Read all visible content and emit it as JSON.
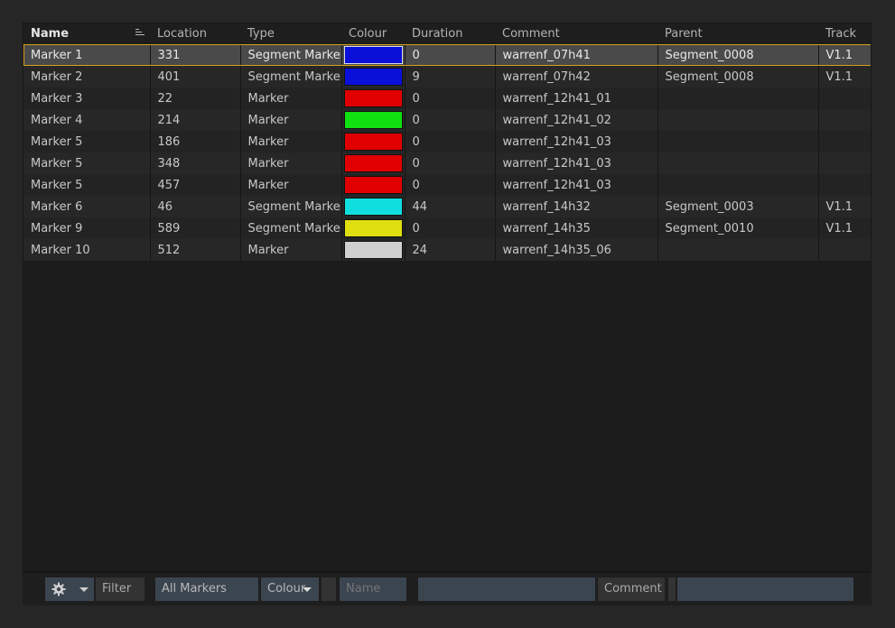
{
  "columns": [
    "Name",
    "Location",
    "Type",
    "Colour",
    "Duration",
    "Comment",
    "Parent",
    "Track"
  ],
  "rows": [
    {
      "name": "Marker 1",
      "location": "331",
      "type": "Segment Marker",
      "colour": "#0a10d8",
      "duration": "0",
      "comment": "warrenf_07h41",
      "parent": "Segment_0008",
      "track": "V1.1",
      "selected": true
    },
    {
      "name": "Marker 2",
      "location": "401",
      "type": "Segment Marker",
      "colour": "#0a10d8",
      "duration": "9",
      "comment": "warrenf_07h42",
      "parent": "Segment_0008",
      "track": "V1.1"
    },
    {
      "name": "Marker 3",
      "location": "22",
      "type": "Marker",
      "colour": "#e00000",
      "duration": "0",
      "comment": "warrenf_12h41_01",
      "parent": "",
      "track": ""
    },
    {
      "name": "Marker 4",
      "location": "214",
      "type": "Marker",
      "colour": "#10e010",
      "duration": "0",
      "comment": "warrenf_12h41_02",
      "parent": "",
      "track": ""
    },
    {
      "name": "Marker 5",
      "location": "186",
      "type": "Marker",
      "colour": "#e00000",
      "duration": "0",
      "comment": "warrenf_12h41_03",
      "parent": "",
      "track": ""
    },
    {
      "name": "Marker 5",
      "location": "348",
      "type": "Marker",
      "colour": "#e00000",
      "duration": "0",
      "comment": "warrenf_12h41_03",
      "parent": "",
      "track": ""
    },
    {
      "name": "Marker 5",
      "location": "457",
      "type": "Marker",
      "colour": "#e00000",
      "duration": "0",
      "comment": "warrenf_12h41_03",
      "parent": "",
      "track": ""
    },
    {
      "name": "Marker 6",
      "location": "46",
      "type": "Segment Marker",
      "colour": "#10dede",
      "duration": "44",
      "comment": "warrenf_14h32",
      "parent": "Segment_0003",
      "track": "V1.1"
    },
    {
      "name": "Marker 9",
      "location": "589",
      "type": "Segment Marker",
      "colour": "#e0e010",
      "duration": "0",
      "comment": "warrenf_14h35",
      "parent": "Segment_0010",
      "track": "V1.1"
    },
    {
      "name": "Marker 10",
      "location": "512",
      "type": "Marker",
      "colour": "#d0d0d0",
      "duration": "24",
      "comment": "warrenf_14h35_06",
      "parent": "",
      "track": ""
    }
  ],
  "toolbar": {
    "settings_icon": "gear-icon",
    "filter_label": "Filter",
    "filter_value": "All Markers",
    "colour_label": "Colour",
    "name_placeholder": "Name",
    "name_value": "",
    "comment_label": "Comment",
    "comment_value": ""
  },
  "colors": {
    "selection_outline": "#d4a017",
    "background": "#262626"
  }
}
